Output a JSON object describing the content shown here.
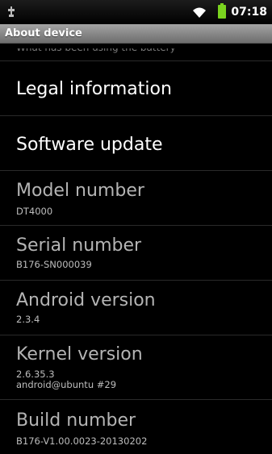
{
  "status_bar": {
    "time": "07:18",
    "icons": [
      "usb-icon",
      "wifi-icon",
      "battery-icon"
    ],
    "battery_color": "#7ad31f"
  },
  "title_bar": {
    "title": "About device"
  },
  "list": {
    "cut_text": "What has been using the battery",
    "items": [
      {
        "title": "Legal information"
      },
      {
        "title": "Software update"
      },
      {
        "title": "Model number",
        "sub1": "DT4000"
      },
      {
        "title": "Serial number",
        "sub1": "B176-SN000039"
      },
      {
        "title": "Android version",
        "sub1": "2.3.4"
      },
      {
        "title": "Kernel version",
        "sub1": "2.6.35.3",
        "sub2": "android@ubuntu #29"
      },
      {
        "title": "Build number",
        "sub1": "B176-V1.00.0023-20130202"
      }
    ]
  }
}
